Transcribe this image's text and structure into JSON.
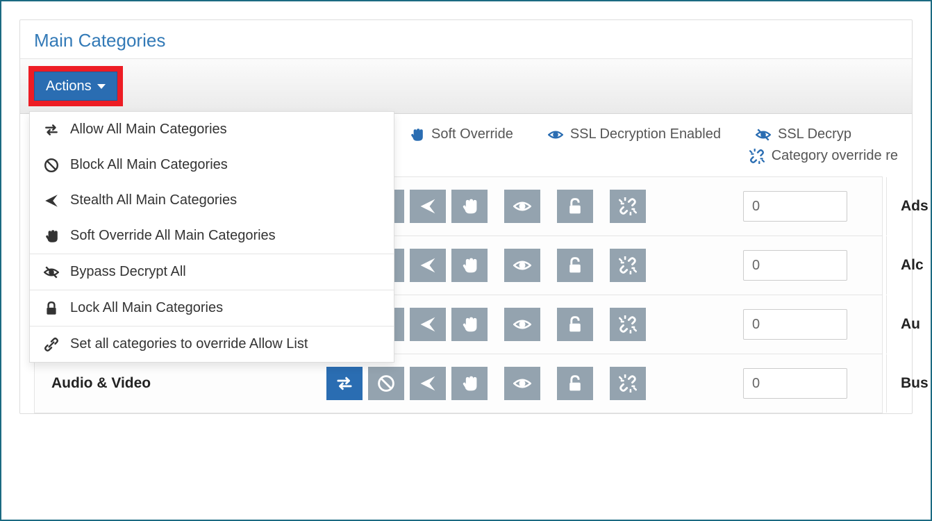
{
  "panel": {
    "title": "Main Categories"
  },
  "toolbar": {
    "actions_label": "Actions"
  },
  "dropdown": {
    "items": [
      {
        "icon": "swap",
        "label": "Allow All Main Categories"
      },
      {
        "icon": "block",
        "label": "Block All Main Categories"
      },
      {
        "icon": "plane",
        "label": "Stealth All Main Categories"
      },
      {
        "icon": "hand",
        "label": "Soft Override All Main Categories"
      }
    ],
    "items2": [
      {
        "icon": "eye-slash",
        "label": "Bypass Decrypt All"
      }
    ],
    "items3": [
      {
        "icon": "lock",
        "label": "Lock All Main Categories"
      }
    ],
    "items4": [
      {
        "icon": "chain",
        "label": "Set all categories to override Allow List"
      }
    ]
  },
  "legend": {
    "soft_override": "Soft Override",
    "ssl_enabled": "SSL Decryption Enabled",
    "ssl_decrypt": "SSL Decryp",
    "category_override": "Category override re"
  },
  "categories": [
    {
      "name": "",
      "count": "0",
      "right": "Ads"
    },
    {
      "name": "",
      "count": "0",
      "right": "Alc"
    },
    {
      "name": "",
      "count": "0",
      "right": "Au"
    },
    {
      "name": "Audio & Video",
      "count": "0",
      "right": "Bus",
      "allow_active": true
    }
  ],
  "colors": {
    "accent": "#2a6db2",
    "highlight": "#ed1c24",
    "border": "#1b6a81",
    "icon_gray": "#94a3af"
  }
}
